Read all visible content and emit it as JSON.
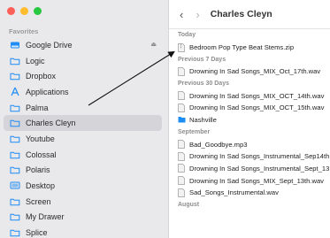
{
  "colors": {
    "close": "#fe5f57",
    "minimize": "#febc2e",
    "zoom": "#28c840",
    "folder_blue": "#1e8cf5"
  },
  "sidebar": {
    "section": "Favorites",
    "items": [
      {
        "label": "Google Drive",
        "icon": "google-drive-icon"
      },
      {
        "label": "Logic",
        "icon": "folder-icon"
      },
      {
        "label": "Dropbox",
        "icon": "folder-icon"
      },
      {
        "label": "Applications",
        "icon": "applications-icon"
      },
      {
        "label": "Palma",
        "icon": "folder-icon"
      },
      {
        "label": "Charles Cleyn",
        "icon": "folder-icon",
        "selected": true
      },
      {
        "label": "Youtube",
        "icon": "folder-icon"
      },
      {
        "label": "Colossal",
        "icon": "folder-icon"
      },
      {
        "label": "Polaris",
        "icon": "folder-icon"
      },
      {
        "label": "Desktop",
        "icon": "desktop-icon"
      },
      {
        "label": "Screen",
        "icon": "folder-icon"
      },
      {
        "label": "My Drawer",
        "icon": "folder-icon"
      },
      {
        "label": "Splice",
        "icon": "folder-icon"
      }
    ]
  },
  "toolbar": {
    "back": "‹",
    "forward": "›",
    "title": "Charles Cleyn"
  },
  "files": {
    "groups": [
      {
        "header": "Today",
        "items": [
          {
            "name": "Bedroom Pop Type Beat Stems.zip",
            "kind": "zip"
          }
        ]
      },
      {
        "header": "Previous 7 Days",
        "items": [
          {
            "name": "Drowning In Sad Songs_MIX_Oct_17th.wav",
            "kind": "doc"
          }
        ]
      },
      {
        "header": "Previous 30 Days",
        "items": [
          {
            "name": "Drowning In Sad Songs_MIX_OCT_14th.wav",
            "kind": "doc"
          },
          {
            "name": "Drowning In Sad Songs_MIX_OCT_15th.wav",
            "kind": "doc"
          },
          {
            "name": "Nashville",
            "kind": "folder"
          }
        ]
      },
      {
        "header": "September",
        "items": [
          {
            "name": "Bad_Goodbye.mp3",
            "kind": "doc"
          },
          {
            "name": "Drowning In Sad Songs_Instrumental_Sep14th",
            "kind": "doc"
          },
          {
            "name": "Drowning In Sad Songs_Instrumental_Sept_13",
            "kind": "doc"
          },
          {
            "name": "Drowning In Sad Songs_MIX_Sept_13th.wav",
            "kind": "doc"
          },
          {
            "name": "Sad_Songs_Instrumental.wav",
            "kind": "doc"
          }
        ]
      },
      {
        "header": "August",
        "items": []
      }
    ]
  }
}
